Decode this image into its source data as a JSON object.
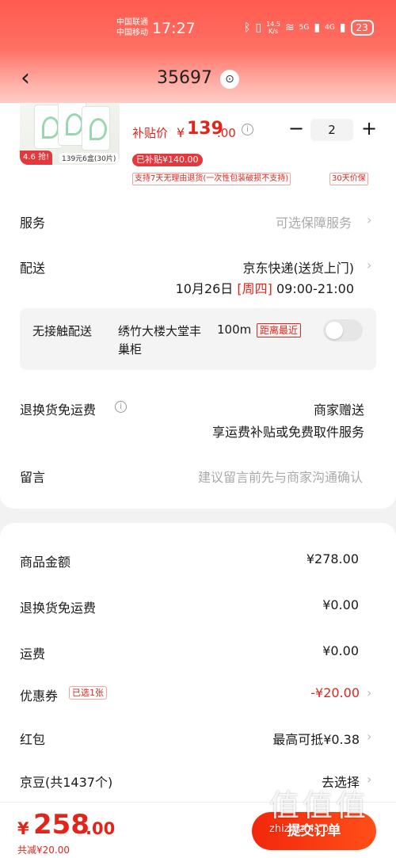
{
  "status_bar": {
    "carrier_1": "中国联通",
    "carrier_2": "中国移动",
    "time": "17:27",
    "speed_value": "14.5",
    "speed_unit": "K/s",
    "net_label_1": "5G",
    "net_label_2": "4G",
    "battery": "23"
  },
  "nav": {
    "back_icon": "chevron-left-icon",
    "title": "35697",
    "location_icon": "location-pin-icon"
  },
  "product": {
    "rating_badge": "4.6 抢!",
    "spec_badge": "139元6盒(30片)",
    "subsidy_price_label": "补贴价",
    "currency": "¥",
    "price_int": "139",
    "price_dec": ".00",
    "info_icon": "info-icon",
    "qty_minus": "−",
    "quantity": "2",
    "qty_plus": "+",
    "subsidy_badge": "已补贴¥140.00",
    "return_policy": "支持7天无理由退货(一次性包装破损不支持)",
    "price_guarantee": "30天价保"
  },
  "order_rows": {
    "service_label": "服务",
    "service_value": "可选保障服务",
    "delivery_label": "配送",
    "delivery_value": "京东快递(送货上门)",
    "delivery_date": "10月26日",
    "delivery_weekday": "[周四]",
    "delivery_time": "09:00-21:00",
    "contactless_label": "无接触配送",
    "contactless_place": "绣竹大楼大堂丰巢柜",
    "contactless_distance": "100m",
    "contactless_nearest": "距离最近",
    "return_shipping_label": "退换货免运费",
    "return_shipping_value": "商家赠送",
    "return_shipping_desc": "享运费补贴或免费取件服务",
    "message_label": "留言",
    "message_placeholder": "建议留言前先与商家沟通确认"
  },
  "summary": {
    "goods_amount_label": "商品金额",
    "goods_amount": "¥278.00",
    "return_free_label": "退换货免运费",
    "return_free_value": "¥0.00",
    "shipping_label": "运费",
    "shipping_value": "¥0.00",
    "coupon_label": "优惠券",
    "coupon_tag": "已选1张",
    "coupon_value": "-¥20.00",
    "redpacket_label": "红包",
    "redpacket_value": "最高可抵¥0.38",
    "jingdou_label": "京豆(共1437个)",
    "jingdou_value": "去选择"
  },
  "bottom_bar": {
    "total_currency": "¥",
    "total_int": "258",
    "total_dec": ".00",
    "discount_text": "共减¥20.00",
    "submit_label": "提交订单"
  },
  "watermark": {
    "logo": "值值值",
    "site": "zhizhizhi.com"
  },
  "colors": {
    "accent_red": "#e1251b",
    "header_gradient_top": "#ff5a4e"
  }
}
